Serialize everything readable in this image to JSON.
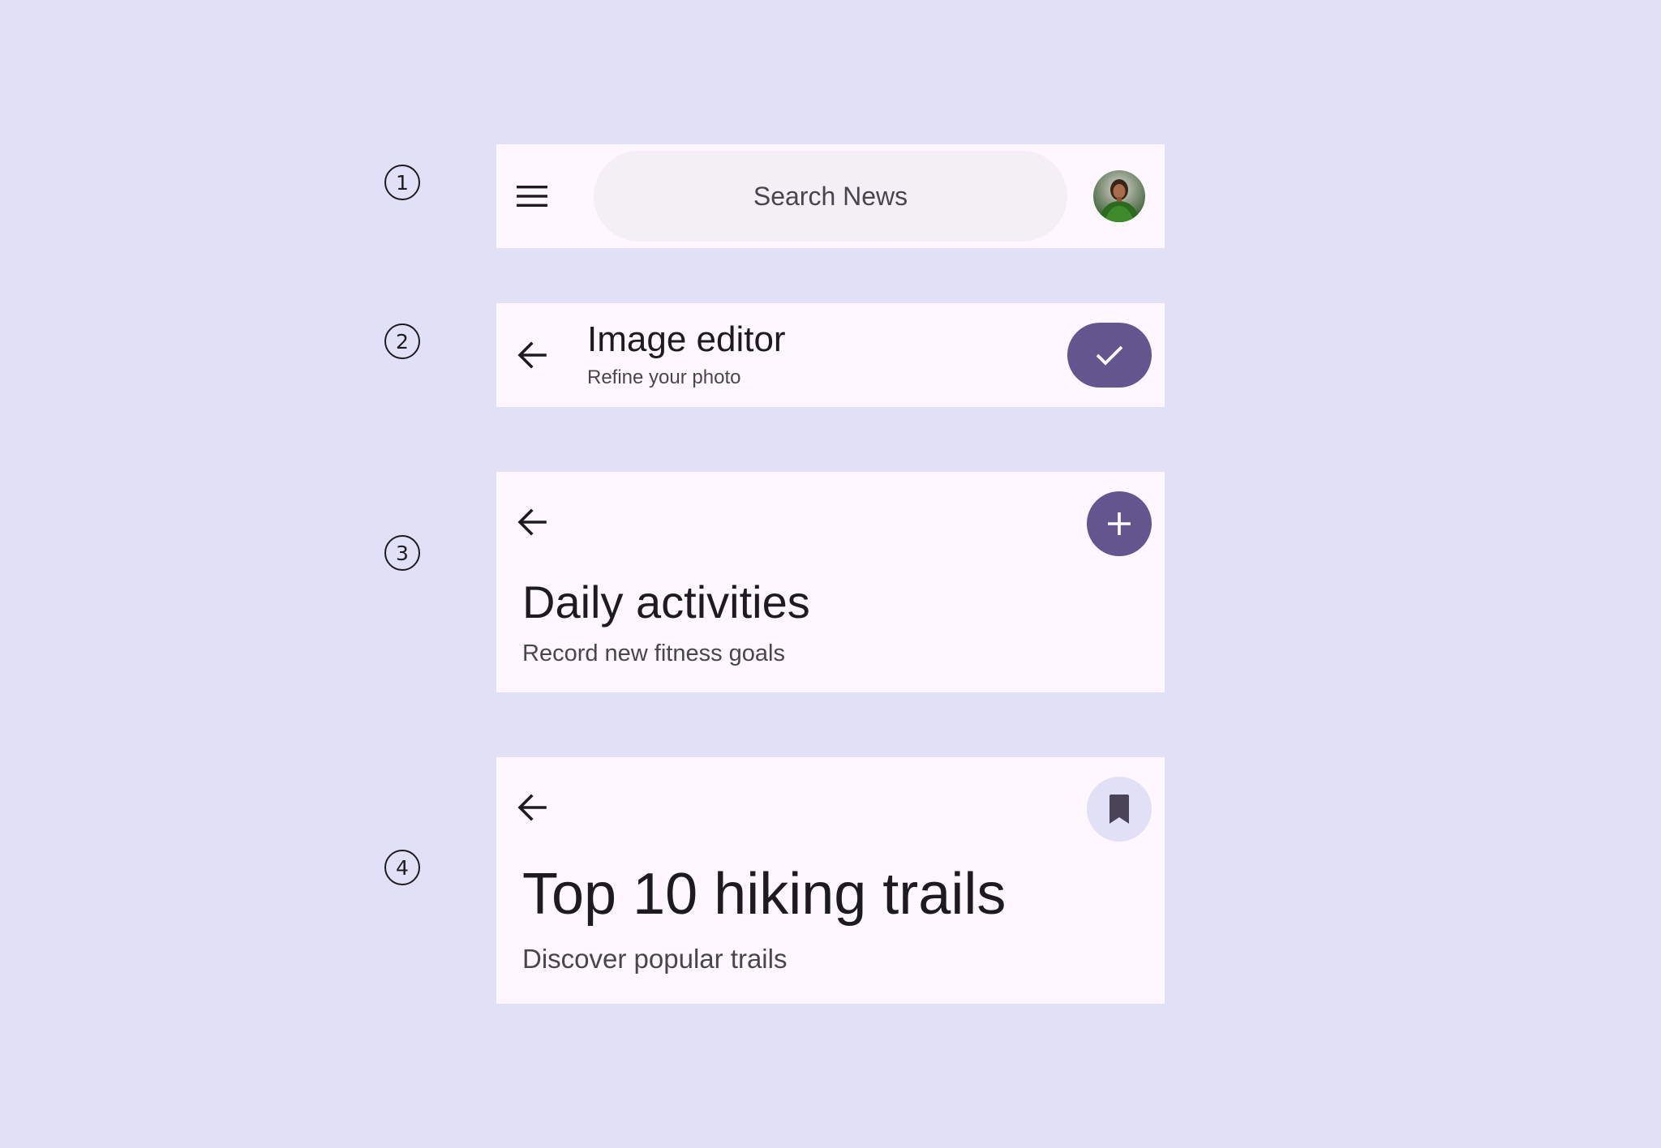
{
  "colors": {
    "background": "#E2E0F7",
    "surface": "#FEF7FF",
    "primary": "#65558F",
    "secondary_container": "#E2E0F7",
    "on_surface": "#1D1B20",
    "on_surface_variant": "#49454F"
  },
  "markers": [
    "1",
    "2",
    "3",
    "4"
  ],
  "search_bar": {
    "menu_icon": "menu-icon",
    "placeholder": "Search News",
    "avatar_icon": "avatar-photo"
  },
  "small_bar": {
    "back_icon": "arrow-back-icon",
    "title": "Image editor",
    "subtitle": "Refine your photo",
    "action_icon": "check-icon"
  },
  "medium_bar": {
    "back_icon": "arrow-back-icon",
    "title": "Daily activities",
    "subtitle": "Record new fitness goals",
    "action_icon": "add-icon"
  },
  "large_bar": {
    "back_icon": "arrow-back-icon",
    "title": "Top 10 hiking trails",
    "subtitle": "Discover popular trails",
    "action_icon": "bookmark-icon"
  }
}
